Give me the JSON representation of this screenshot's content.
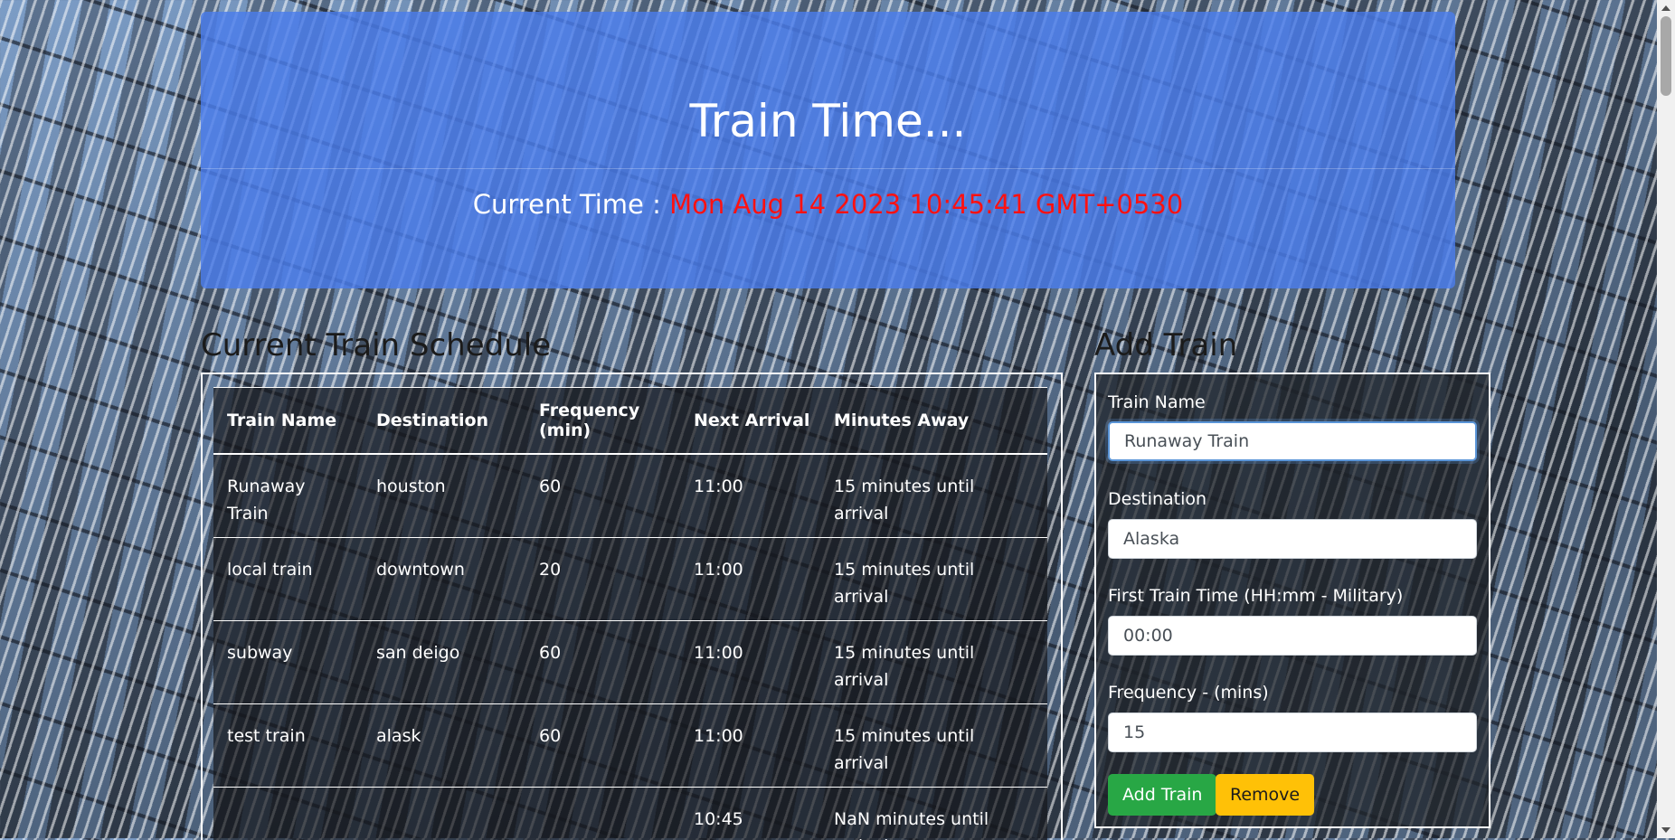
{
  "header": {
    "title": "Train Time...",
    "time_label": "Current Time : ",
    "time_value": "Mon Aug 14 2023 10:45:41 GMT+0530"
  },
  "schedule": {
    "title": "Current Train Schedule",
    "columns": [
      "Train Name",
      "Destination",
      "Frequency (min)",
      "Next Arrival",
      "Minutes Away"
    ],
    "rows": [
      [
        "Runaway Train",
        "houston",
        "60",
        "11:00",
        "15 minutes until arrival"
      ],
      [
        "local train",
        "downtown",
        "20",
        "11:00",
        "15 minutes until arrival"
      ],
      [
        "subway",
        "san deigo",
        "60",
        "11:00",
        "15 minutes until arrival"
      ],
      [
        "test train",
        "alask",
        "60",
        "11:00",
        "15 minutes until arrival"
      ],
      [
        "",
        "",
        "",
        "10:45",
        "NaN minutes until arrival"
      ]
    ]
  },
  "form": {
    "title": "Add Train",
    "train_name_label": "Train Name",
    "train_name_value": "Runaway Train",
    "destination_label": "Destination",
    "destination_value": "Alaska",
    "first_time_label": "First Train Time (HH:mm - Military)",
    "first_time_value": "00:00",
    "frequency_label": "Frequency - (mins)",
    "frequency_value": "15",
    "add_label": "Add Train",
    "remove_label": "Remove"
  },
  "colors": {
    "jumbotron": "#4b7deb",
    "clock": "#ff1111",
    "add_button": "#28a745",
    "remove_button": "#ffc107"
  }
}
